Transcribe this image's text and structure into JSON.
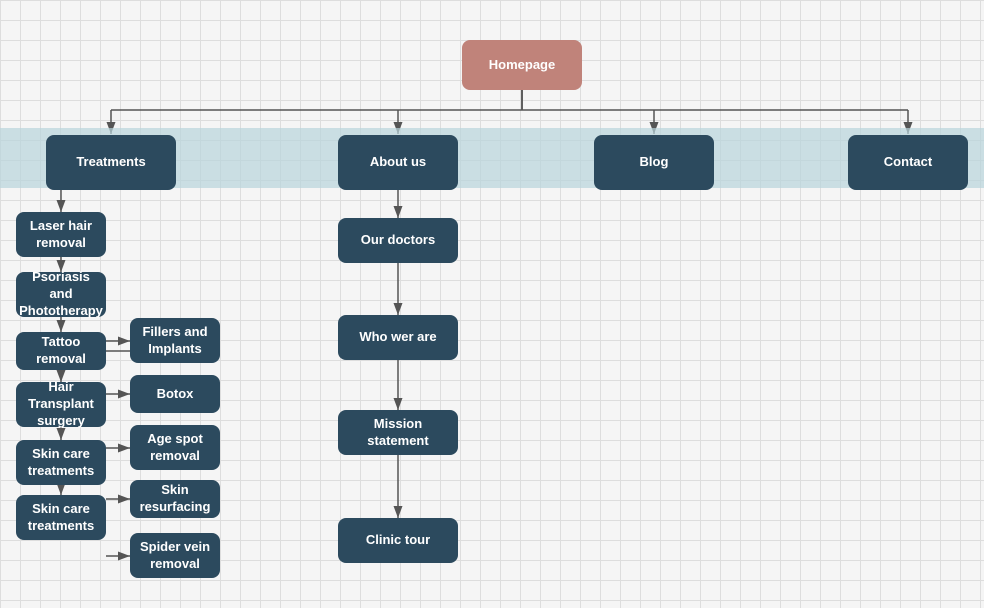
{
  "nodes": {
    "homepage": {
      "label": "Homepage"
    },
    "treatments": {
      "label": "Treatments"
    },
    "aboutus": {
      "label": "About us"
    },
    "blog": {
      "label": "Blog"
    },
    "contact": {
      "label": "Contact"
    },
    "laser": {
      "label": "Laser hair removal"
    },
    "psoriasis": {
      "label": "Psoriasis and Phototherapy"
    },
    "tattoo": {
      "label": "Tattoo removal"
    },
    "hair_transplant": {
      "label": "Hair Transplant surgery"
    },
    "skincare1": {
      "label": "Skin care treatments"
    },
    "skincare2": {
      "label": "Skin care treatments"
    },
    "fillers": {
      "label": "Fillers and Implants"
    },
    "botox": {
      "label": "Botox"
    },
    "agespot": {
      "label": "Age spot removal"
    },
    "skinresurfacing": {
      "label": "Skin resurfacing"
    },
    "spidervein": {
      "label": "Spider vein removal"
    },
    "ourdoctors": {
      "label": "Our doctors"
    },
    "whoweare": {
      "label": "Who wer are"
    },
    "mission": {
      "label": "Mission statement"
    },
    "clinictour": {
      "label": "Clinic tour"
    }
  }
}
